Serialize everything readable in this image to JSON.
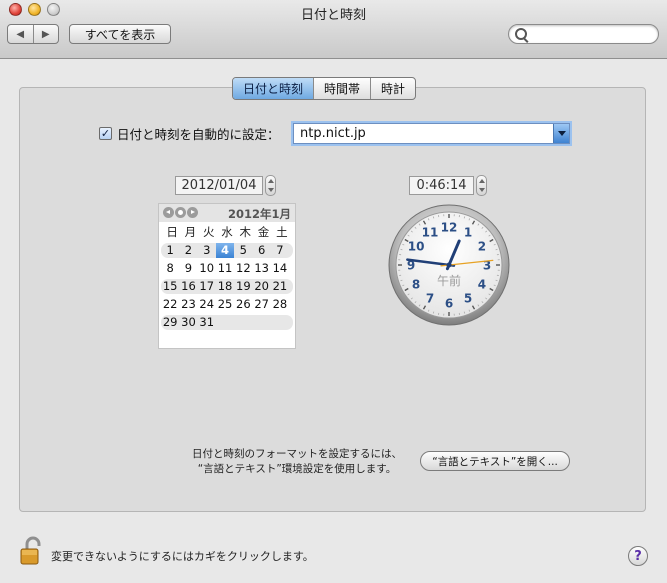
{
  "window": {
    "title": "日付と時刻"
  },
  "toolbar": {
    "back_label": "◀",
    "forward_label": "▶",
    "show_all_label": "すべてを表示",
    "search_placeholder": "",
    "search_value": ""
  },
  "tabs": [
    {
      "label": "日付と時刻",
      "active": true
    },
    {
      "label": "時間帯",
      "active": false
    },
    {
      "label": "時計",
      "active": false
    }
  ],
  "auto_set": {
    "checked": true,
    "check_mark": "✓",
    "label": "日付と時刻を自動的に設定：",
    "server": "ntp.nict.jp"
  },
  "date_field": "2012/01/04",
  "time_field": "0:46:14",
  "calendar": {
    "month_label": "2012年1月",
    "weekdays": [
      "日",
      "月",
      "火",
      "水",
      "木",
      "金",
      "土"
    ],
    "weeks": [
      [
        "1",
        "2",
        "3",
        "4",
        "5",
        "6",
        "7"
      ],
      [
        "8",
        "9",
        "10",
        "11",
        "12",
        "13",
        "14"
      ],
      [
        "15",
        "16",
        "17",
        "18",
        "19",
        "20",
        "21"
      ],
      [
        "22",
        "23",
        "24",
        "25",
        "26",
        "27",
        "28"
      ],
      [
        "29",
        "30",
        "31",
        "",
        "",
        "",
        ""
      ]
    ],
    "selected_day": "4"
  },
  "clock": {
    "numerals": [
      "12",
      "1",
      "2",
      "3",
      "4",
      "5",
      "6",
      "7",
      "8",
      "9",
      "10",
      "11"
    ],
    "ampm_label": "午前",
    "time": {
      "hours": 0,
      "minutes": 46,
      "seconds": 14
    },
    "colors": {
      "numerals": "#2c4f86",
      "second_hand": "#e7a224",
      "hand": "#203f77"
    }
  },
  "format": {
    "text_line1": "日付と時刻のフォーマットを設定するには、",
    "text_line2": "“言語とテキスト”環境設定を使用します。",
    "button_label": "“言語とテキスト”を開く..."
  },
  "lock": {
    "text": "変更できないようにするにはカギをクリックします。"
  },
  "help": {
    "label": "?"
  },
  "colors": {
    "accent": "#3b83d4",
    "panel_bg": "#dcdcdc",
    "window_bg": "#e8e8e8"
  }
}
